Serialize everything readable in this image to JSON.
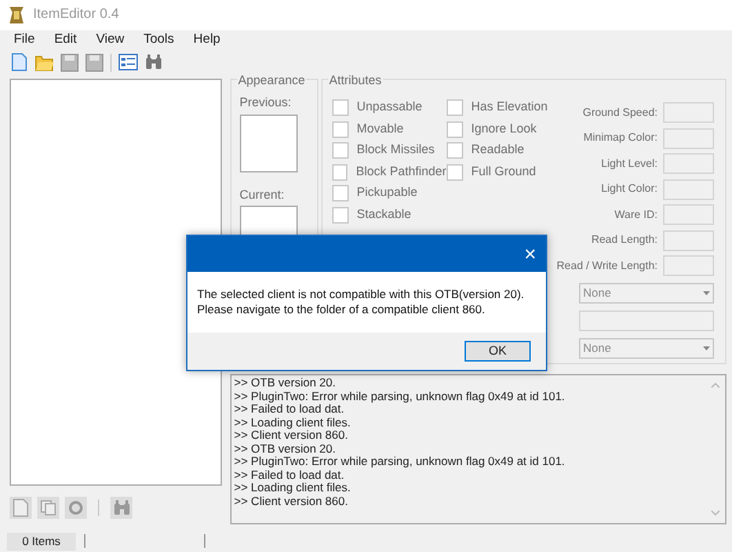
{
  "window": {
    "title": "ItemEditor 0.4"
  },
  "menu": [
    "File",
    "Edit",
    "View",
    "Tools",
    "Help"
  ],
  "appearance": {
    "title": "Appearance",
    "previous": "Previous:",
    "current": "Current:"
  },
  "attributes": {
    "title": "Attributes",
    "flags_left": [
      {
        "label": "Unpassable",
        "checked": false
      },
      {
        "label": "Movable",
        "checked": false
      },
      {
        "label": "Block Missiles",
        "checked": false
      },
      {
        "label": "Block Pathfinder",
        "checked": false
      },
      {
        "label": "Pickupable",
        "checked": false
      },
      {
        "label": "Stackable",
        "checked": false
      }
    ],
    "flags_right": [
      {
        "label": "Has Elevation",
        "checked": false
      },
      {
        "label": "Ignore Look",
        "checked": false
      },
      {
        "label": "Readable",
        "checked": false
      },
      {
        "label": "Full Ground",
        "checked": false
      }
    ],
    "properties": [
      "Ground Speed:",
      "Minimap Color:",
      "Light Level:",
      "Light Color:",
      "Ware ID:",
      "Read Length:",
      "Read / Write Length:"
    ],
    "selectors": [
      {
        "kind": "combo",
        "value": "None"
      },
      {
        "kind": "field"
      },
      {
        "kind": "combo",
        "value": "None"
      }
    ]
  },
  "log": [
    ">> OTB version 20.",
    ">> PluginTwo: Error while parsing, unknown flag 0x49 at id 101.",
    ">> Failed to load dat.",
    ">> Loading client files.",
    ">> Client version 860.",
    ">> OTB version 20.",
    ">> PluginTwo: Error while parsing, unknown flag 0x49 at id 101.",
    ">> Failed to load dat.",
    ">> Loading client files.",
    ">> Client version 860."
  ],
  "status_bar": {
    "items": "0 Items"
  },
  "dialog": {
    "message": "The selected client is not compatible with this OTB(version 20). Please navigate to the folder of a compatible client 860.",
    "close": "×",
    "button": "OK"
  }
}
